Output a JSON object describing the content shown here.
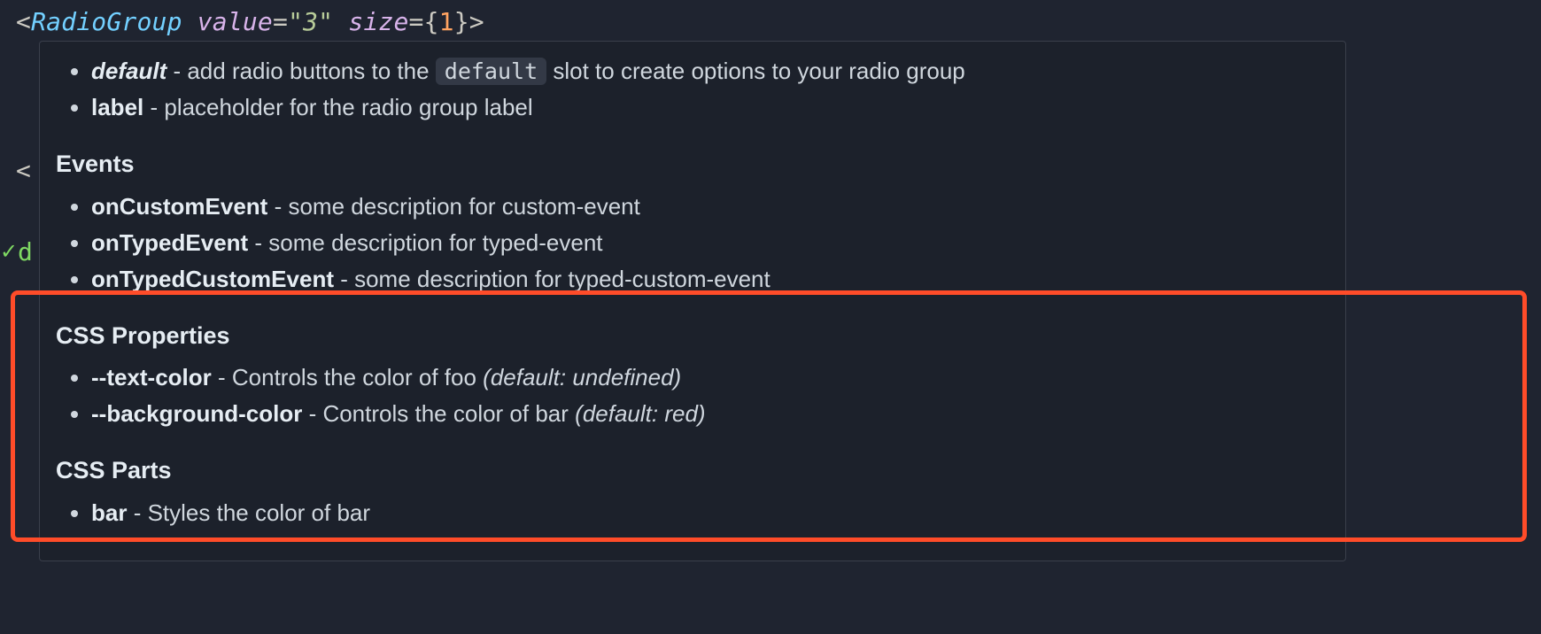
{
  "code": {
    "component": "RadioGroup",
    "attr1_name": "value",
    "attr1_value": "\"3\"",
    "attr2_name": "size",
    "attr2_value": "1"
  },
  "bg": {
    "angle": "<",
    "check": "✓",
    "d": "d"
  },
  "slots": [
    {
      "name": "default",
      "style": "italic",
      "desc_pre": " - add radio buttons to the ",
      "pill": "default",
      "desc_post": " slot to create options to your radio group"
    },
    {
      "name": "label",
      "style": "bold",
      "desc": " - placeholder for the radio group label"
    }
  ],
  "events_heading": "Events",
  "events": [
    {
      "name": "onCustomEvent",
      "desc": " - some description for custom-event"
    },
    {
      "name": "onTypedEvent",
      "desc": " - some description for typed-event"
    },
    {
      "name": "onTypedCustomEvent",
      "desc": " - some description for typed-custom-event"
    }
  ],
  "cssprops_heading": "CSS Properties",
  "cssprops": [
    {
      "name": "--text-color",
      "desc": " - Controls the color of foo ",
      "default": "(default: undefined)"
    },
    {
      "name": "--background-color",
      "desc": " - Controls the color of bar ",
      "default": "(default: red)"
    }
  ],
  "cssparts_heading": "CSS Parts",
  "cssparts": [
    {
      "name": "bar",
      "desc": " - Styles the color of bar"
    }
  ]
}
